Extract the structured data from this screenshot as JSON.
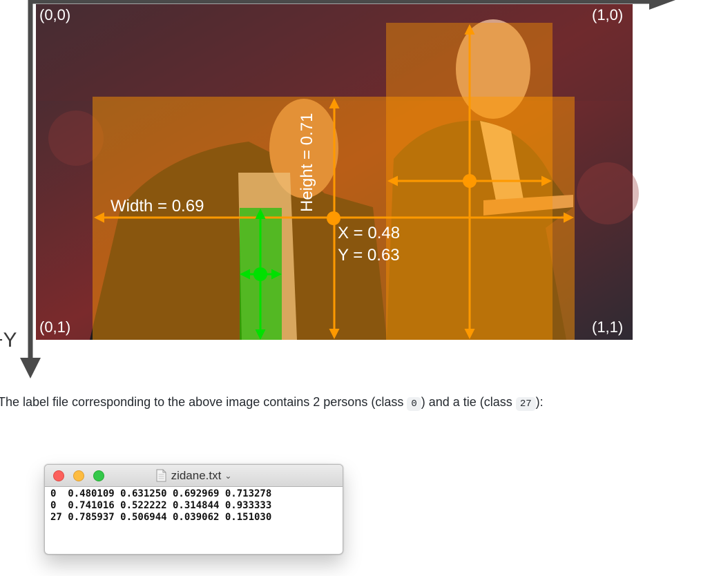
{
  "figure": {
    "corner_labels": {
      "top_left": "(0,0)",
      "top_right": "(1,0)",
      "bottom_left": "(0,1)",
      "bottom_right": "(1,1)"
    },
    "y_axis_label": "+Y",
    "width_label": "Width = 0.69",
    "height_label": "Height = 0.71",
    "x_label": "X = 0.48",
    "y_label": "Y = 0.63",
    "colors": {
      "person_box": "#ff9900",
      "tie_box": "#00cc00",
      "axis": "#4a4a4a"
    }
  },
  "caption": {
    "prefix": "The label file corresponding to the above image contains 2 persons (class ",
    "code1": "0",
    "middle": ") and a tie (class ",
    "code2": "27",
    "suffix": "):"
  },
  "file_window": {
    "title": "zidane.txt",
    "lines": [
      "0  0.480109 0.631250 0.692969 0.713278",
      "0  0.741016 0.522222 0.314844 0.933333",
      "27 0.785937 0.506944 0.039062 0.151030"
    ]
  }
}
